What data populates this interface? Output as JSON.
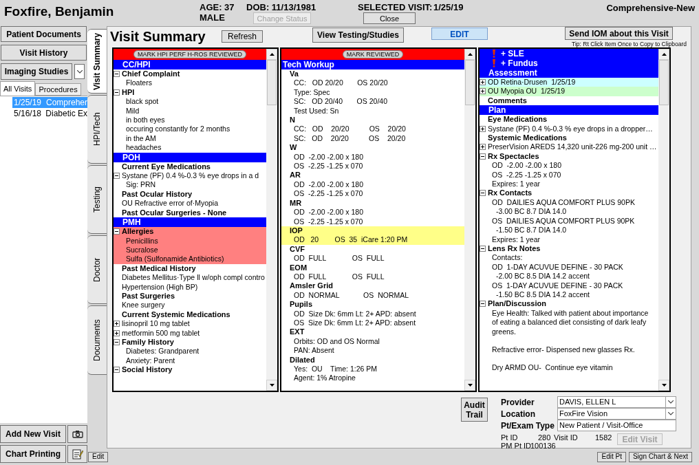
{
  "header": {
    "patient_name": "Foxfire, Benjamin",
    "age": "AGE: 37",
    "sex": "MALE",
    "dob": "DOB: 11/13/1981",
    "selected_visit_label": "SELECTED VISIT:",
    "selected_visit": "1/25/19",
    "visit_type": "Comprehensive-New",
    "buttons": [
      {
        "label": "Change Status",
        "disabled": true
      },
      {
        "label": "Close",
        "disabled": false
      }
    ]
  },
  "left_panel": {
    "buttons": [
      "Patient Documents",
      "Visit History"
    ],
    "imaging_button": "Imaging Studies",
    "tabs": [
      {
        "label": "All Visits",
        "selected": true
      },
      {
        "label": "Procedures",
        "selected": false
      }
    ],
    "visits": [
      {
        "date": "1/25/19",
        "type": "Compreher",
        "selected": true
      },
      {
        "date": "5/16/18",
        "type": "Diabetic Ex",
        "selected": false
      }
    ],
    "bottom_buttons": [
      "Add New Visit",
      "Chart Printing"
    ]
  },
  "side_tabs": [
    {
      "label": "Visit Summary",
      "selected": true
    },
    {
      "label": "HPI/Tech",
      "selected": false
    },
    {
      "label": "Testing",
      "selected": false
    },
    {
      "label": "Doctor",
      "selected": false
    },
    {
      "label": "Documents",
      "selected": false
    }
  ],
  "summary": {
    "title": "Visit Summary",
    "refresh": "Refresh",
    "view_testing": "View Testing/Studies",
    "edit": "EDIT",
    "send_iom": "Send IOM about this Visit",
    "tip": "Tip: Rt Click Item Once to Copy to Clipboard",
    "panels": [
      {
        "mark_button": "MARK HPI PERF H-ROS REVIEWED",
        "rows": [
          {
            "kind": "band",
            "text": "CC/HPI"
          },
          {
            "kind": "heading",
            "text": "Chief Complaint",
            "expanded": true,
            "children": [
              {
                "kind": "item",
                "text": "Floaters"
              }
            ]
          },
          {
            "kind": "heading",
            "text": "HPI",
            "expanded": true,
            "children": [
              {
                "kind": "item",
                "text": "black spot"
              },
              {
                "kind": "item",
                "text": "Mild"
              },
              {
                "kind": "item",
                "text": "in both eyes"
              },
              {
                "kind": "item",
                "text": "occuring constantly for 2 months"
              },
              {
                "kind": "item",
                "text": "in the AM"
              },
              {
                "kind": "item",
                "text": "headaches"
              }
            ]
          },
          {
            "kind": "band",
            "text": "POH"
          },
          {
            "kind": "heading",
            "text": "Current Eye Medications"
          },
          {
            "kind": "item",
            "text": "Systane (PF) 0.4 %-0.3 % eye drops in a d",
            "expanded": true,
            "children": [
              {
                "kind": "item",
                "text": "Sig: PRN"
              }
            ]
          },
          {
            "kind": "heading",
            "text": "Past Ocular History"
          },
          {
            "kind": "item",
            "text": "OU Refractive error of·Myopia"
          },
          {
            "kind": "heading",
            "text": "Past Ocular Surgeries - None"
          },
          {
            "kind": "band",
            "text": "PMH"
          },
          {
            "kind": "heading",
            "text": "Allergies",
            "expanded": true,
            "color": "#ff8080",
            "children": [
              {
                "kind": "item",
                "text": "Penicillins"
              },
              {
                "kind": "item",
                "text": "Sucralose"
              },
              {
                "kind": "item",
                "text": "Sulfa (Sulfonamide Antibiotics)"
              }
            ]
          },
          {
            "kind": "heading",
            "text": "Past Medical History"
          },
          {
            "kind": "item",
            "text": "Diabetes Mellitus·Type ll w/oph compl contro"
          },
          {
            "kind": "item",
            "text": "Hypertension (High BP)"
          },
          {
            "kind": "heading",
            "text": "Past Surgeries"
          },
          {
            "kind": "item",
            "text": "Knee surgery"
          },
          {
            "kind": "heading",
            "text": "Current Systemic Medications"
          },
          {
            "kind": "item",
            "text": "lisinopril 10 mg tablet",
            "expanded": false
          },
          {
            "kind": "item",
            "text": "metformin 500 mg tablet",
            "expanded": false
          },
          {
            "kind": "heading",
            "text": "Family History",
            "expanded": true,
            "children": [
              {
                "kind": "item",
                "text": "Diabetes: Grandparent"
              },
              {
                "kind": "item",
                "text": "Anxiety: Parent"
              }
            ]
          },
          {
            "kind": "heading",
            "text": "Social History",
            "expanded": true
          }
        ]
      },
      {
        "mark_button": "MARK REVIEWED",
        "rows": [
          {
            "kind": "band",
            "text": "Tech Workup",
            "flush": true
          },
          {
            "kind": "heading",
            "text": "Va",
            "children": [
              {
                "kind": "item",
                "text": "CC:   OD 20/20       OS 20/20"
              },
              {
                "kind": "item",
                "text": "Type: Spec"
              },
              {
                "kind": "item",
                "text": "SC:   OD 20/40       OS 20/40"
              },
              {
                "kind": "item",
                "text": "Test Used: Sn"
              }
            ]
          },
          {
            "kind": "heading",
            "text": "N",
            "children": [
              {
                "kind": "item",
                "text": "CC:   OD    20/20          OS    20/20"
              },
              {
                "kind": "item",
                "text": "SC:   OD    20/20          OS    20/20"
              }
            ]
          },
          {
            "kind": "heading",
            "text": "W",
            "children": [
              {
                "kind": "item",
                "text": "OD  -2.00 -2.00 x 180"
              },
              {
                "kind": "item",
                "text": "OS  -2.25 -1.25 x 070"
              }
            ]
          },
          {
            "kind": "heading",
            "text": "AR",
            "children": [
              {
                "kind": "item",
                "text": "OD  -2.00 -2.00 x 180"
              },
              {
                "kind": "item",
                "text": "OS  -2.25 -1.25 x 070"
              }
            ]
          },
          {
            "kind": "heading",
            "text": "MR",
            "children": [
              {
                "kind": "item",
                "text": "OD  -2.00 -2.00 x 180"
              },
              {
                "kind": "item",
                "text": "OS  -2.25 -1.25 x 070"
              }
            ]
          },
          {
            "kind": "heading",
            "text": "IOP",
            "color": "#ffff88",
            "children": [
              {
                "kind": "item",
                "text": "OD   20        OS  35  iCare 1:20 PM"
              }
            ]
          },
          {
            "kind": "heading",
            "text": "CVF",
            "children": [
              {
                "kind": "item",
                "text": "OD  FULL             OS  FULL"
              }
            ]
          },
          {
            "kind": "heading",
            "text": "EOM",
            "children": [
              {
                "kind": "item",
                "text": "OD  FULL             OS  FULL"
              }
            ]
          },
          {
            "kind": "heading",
            "text": "Amsler Grid",
            "children": [
              {
                "kind": "item",
                "text": "OD  NORMAL            OS  NORMAL"
              }
            ]
          },
          {
            "kind": "heading",
            "text": "Pupils",
            "children": [
              {
                "kind": "item",
                "text": "OD  Size Dk: 6mm Lt: 2+ APD: absent"
              },
              {
                "kind": "item",
                "text": "OS  Size Dk: 6mm Lt: 2+ APD: absent"
              }
            ]
          },
          {
            "kind": "heading",
            "text": "EXT",
            "children": [
              {
                "kind": "item",
                "text": "Orbits: OD and OS Normal"
              },
              {
                "kind": "item",
                "text": "PAN: Absent"
              }
            ]
          },
          {
            "kind": "heading",
            "text": "Dilated",
            "children": [
              {
                "kind": "item",
                "text": "Yes:  OU    Time: 1:26 PM"
              },
              {
                "kind": "item",
                "text": "Agent: 1% Atropine"
              }
            ]
          }
        ]
      },
      {
        "rows": [
          {
            "kind": "band",
            "text": "+ SLE",
            "alert": true
          },
          {
            "kind": "band",
            "text": "+ Fundus",
            "alert": true
          },
          {
            "kind": "band",
            "text": "Assessment"
          },
          {
            "kind": "item",
            "text": "OD Retina·Drusen  1/25/19",
            "expanded": false,
            "color": "#ccffff"
          },
          {
            "kind": "item",
            "text": "OU Myopia OU  1/25/19",
            "expanded": false,
            "color": "#ccffcc"
          },
          {
            "kind": "heading",
            "text": "Comments"
          },
          {
            "kind": "band",
            "text": "Plan"
          },
          {
            "kind": "heading",
            "text": "Eye Medications"
          },
          {
            "kind": "item",
            "text": "Systane (PF) 0.4 %-0.3 % eye drops in a dropper…",
            "expanded": false
          },
          {
            "kind": "heading",
            "text": "Systemic Medications"
          },
          {
            "kind": "item",
            "text": "PreserVision AREDS 14,320 unit-226 mg-200 unit …",
            "expanded": false
          },
          {
            "kind": "heading",
            "text": "Rx Spectacles",
            "expanded": true,
            "children": [
              {
                "kind": "item",
                "text": "OD  -2.00 -2.00 x 180"
              },
              {
                "kind": "item",
                "text": "OS  -2.25 -1.25 x 070"
              },
              {
                "kind": "item",
                "text": "Expires: 1 year"
              }
            ]
          },
          {
            "kind": "heading",
            "text": "Rx Contacts",
            "expanded": true,
            "children": [
              {
                "kind": "item",
                "text": "OD  DAILIES AQUA COMFORT PLUS 90PK",
                "children": [
                  {
                    "kind": "item",
                    "text": "-3.00 BC 8.7 DIA 14.0"
                  }
                ]
              },
              {
                "kind": "item",
                "text": "OS  DAILIES AQUA COMFORT PLUS 90PK",
                "children": [
                  {
                    "kind": "item",
                    "text": "-1.50 BC 8.7 DIA 14.0"
                  }
                ]
              },
              {
                "kind": "item",
                "text": "Expires: 1 year"
              }
            ]
          },
          {
            "kind": "heading",
            "text": "Lens Rx Notes",
            "expanded": true,
            "children": [
              {
                "kind": "item",
                "text": "Contacts:"
              },
              {
                "kind": "item",
                "text": "OD  1-DAY ACUVUE DEFINE - 30 PACK",
                "children": [
                  {
                    "kind": "item",
                    "text": "-2.00 BC 8.5 DIA 14.2 accent"
                  }
                ]
              },
              {
                "kind": "item",
                "text": "OS  1-DAY ACUVUE DEFINE - 30 PACK",
                "children": [
                  {
                    "kind": "item",
                    "text": "-1.50 BC 8.5 DIA 14.2 accent"
                  }
                ]
              }
            ]
          },
          {
            "kind": "heading",
            "text": "Plan/Discussion",
            "expanded": true,
            "children": [
              {
                "kind": "para",
                "text": "Eye Health: Talked with patient about importance of eating a balanced diet consisting of dark leafy greens."
              },
              {
                "kind": "para",
                "text": "Refractive error- Dispensed new glasses Rx."
              },
              {
                "kind": "item",
                "text": "Dry ARMD OU-  Continue eye vitamin"
              }
            ]
          }
        ]
      }
    ]
  },
  "visit_info": {
    "audit_trail": "Audit Trail",
    "fields": [
      {
        "label": "Provider",
        "value": "DAVIS, ELLEN L",
        "kind": "dropdown"
      },
      {
        "label": "Location",
        "value": "FoxFire Vision",
        "kind": "dropdown"
      },
      {
        "label": "Pt/Exam Type",
        "value": "New Patient / Visit-Office",
        "kind": "text"
      }
    ],
    "ids": [
      {
        "label": "Pt ID",
        "value": "280"
      },
      {
        "label": "Visit ID",
        "value": "1582"
      },
      {
        "label": "PM Pt ID",
        "value": "100136"
      }
    ],
    "edit_visit": {
      "label": "Edit Visit",
      "disabled": true
    }
  },
  "footer": {
    "left_button": "Edit",
    "right_buttons": [
      "Edit Pt",
      "Sign Chart & Next"
    ]
  }
}
